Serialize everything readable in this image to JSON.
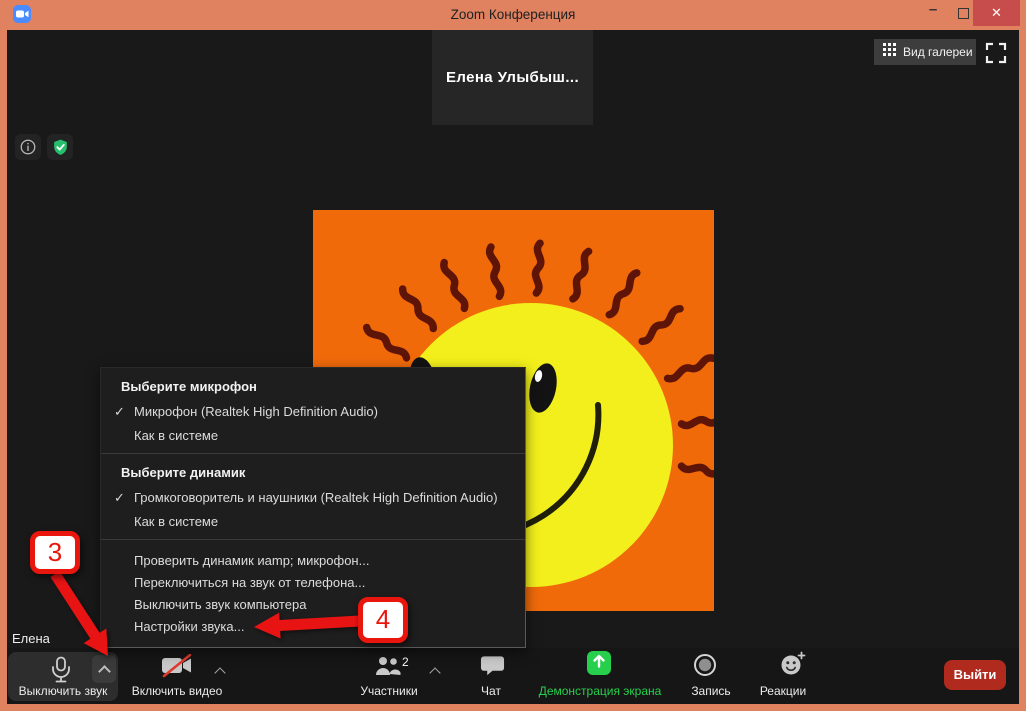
{
  "titlebar": {
    "title": "Zoom Конференция"
  },
  "window_controls": {
    "minimize_icon": "–",
    "close_icon": "✕"
  },
  "stage": {
    "tile_name": "Елена  Улыбыш...",
    "gallery_button": "Вид галереи",
    "self_name": "Елена"
  },
  "audio_menu": {
    "check_icon": "✓",
    "mic_header": "Выберите микрофон",
    "mic_items": [
      {
        "label": "Микрофон (Realtek High Definition Audio)",
        "checked": true
      },
      {
        "label": "Как в системе",
        "checked": false
      }
    ],
    "speaker_header": "Выберите динамик",
    "speaker_items": [
      {
        "label": "Громкоговоритель и наушники (Realtek High Definition Audio)",
        "checked": true
      },
      {
        "label": "Как в системе",
        "checked": false
      }
    ],
    "actions": [
      {
        "label": "Проверить динамик иamp; микрофон..."
      },
      {
        "label": "Переключиться на звук от телефона..."
      },
      {
        "label": "Выключить звук компьютера"
      },
      {
        "label": "Настройки звука..."
      }
    ]
  },
  "toolbar": {
    "mute_label": "Выключить звук",
    "video_label": "Включить видео",
    "participants_label": "Участники",
    "participants_count": "2",
    "chat_label": "Чат",
    "share_label": "Демонстрация экрана",
    "record_label": "Запись",
    "reactions_label": "Реакции",
    "leave_label": "Выйти"
  },
  "callouts": {
    "step_3": "3",
    "step_4": "4"
  },
  "colors": {
    "chrome": "#e08260",
    "share_green": "#27d04c",
    "leave_red": "#b02a1e",
    "callout_red": "#e9160e",
    "sun_orange": "#f06a0a",
    "sun_yellow": "#f2ef1c"
  }
}
